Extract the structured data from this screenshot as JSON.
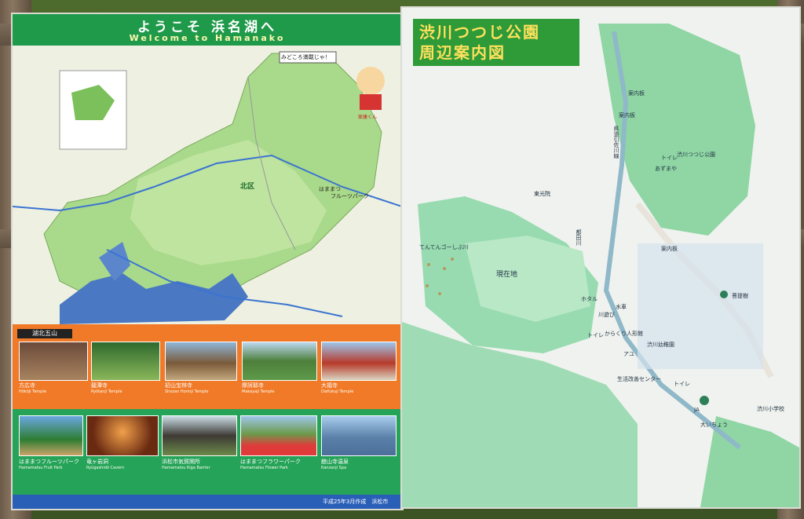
{
  "left_board": {
    "title_jp": "ようこそ 浜名湖へ",
    "title_en": "Welcome to Hamanako",
    "callout": "みどころ満載じゃ！",
    "mascot_name": "家康くん",
    "district": "北区",
    "section_title": "湖北五山",
    "temples": [
      {
        "name": "方広寺",
        "en": "Hōkōji Temple"
      },
      {
        "name": "龍潭寺",
        "en": "Ryōtanji Temple"
      },
      {
        "name": "初山宝林寺",
        "en": "Shozan Horinji Temple"
      },
      {
        "name": "摩訶耶寺",
        "en": "Makayaji Temple"
      },
      {
        "name": "大福寺",
        "en": "Daifukuji Temple"
      }
    ],
    "attractions": [
      {
        "name": "はままつフルーツパーク",
        "en": "Hamamatsu Fruit Park"
      },
      {
        "name": "竜ヶ岩洞",
        "en": "Ryūgashidō Cavern"
      },
      {
        "name": "浜松市気賀関所",
        "en": "Hamamatsu Kiga Barrier"
      },
      {
        "name": "はままつフラワーパーク",
        "en": "Hamamatsu Flower Park"
      },
      {
        "name": "舘山寺温泉",
        "en": "Kanzanji Spa"
      }
    ],
    "map_labels": [
      "はままつ",
      "フルーツパーク"
    ],
    "footer": "平成25年3月作成　浜松市"
  },
  "right_board": {
    "title_line1": "渋川つつじ公園",
    "title_line2": "周辺案内図",
    "labels": {
      "tenten": "てんてんゴーしぶ川",
      "current": "現在地",
      "park": "渋川つつじ公園",
      "toilet1": "トイレ",
      "azumaya": "あずまや",
      "guide1": "案内板",
      "guide2": "案内板",
      "guide3": "案内板",
      "tokoin": "東光院",
      "hotaru": "ホタル",
      "suisha": "水車",
      "kawaasobi": "川遊び",
      "toilet2": "トイレ",
      "kararinko": "からくり人形館",
      "kindergarten": "渋川幼稚園",
      "aku": "アユ",
      "center": "生活改善センター",
      "toilet3": "トイレ",
      "ja": "JA",
      "oicho": "大いちょう",
      "school": "渋川小学校",
      "bodhi": "菩提樹",
      "river": "都田川",
      "road": "県道引佐川線"
    }
  },
  "colors": {
    "left_header": "#1f9a4a",
    "orange_strip": "#f07a28",
    "green_strip": "#25a358",
    "right_title_bg": "#2f9a38",
    "right_title_text": "#ffe15c"
  }
}
